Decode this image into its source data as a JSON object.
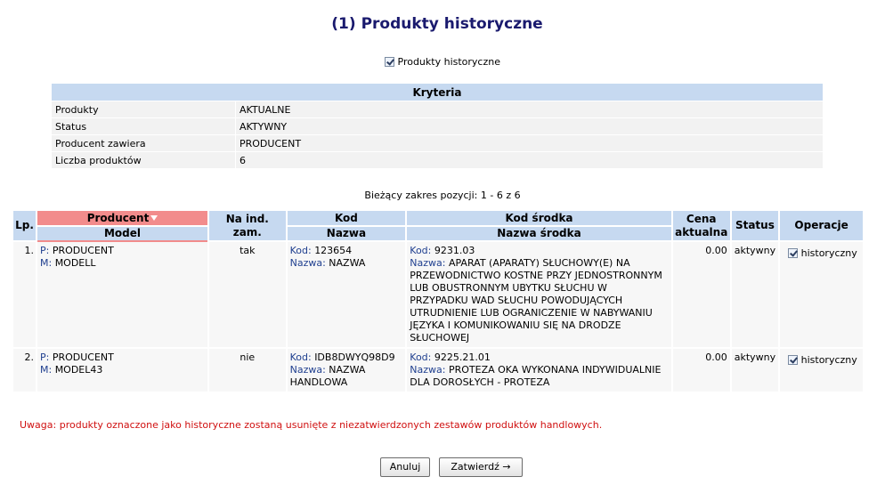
{
  "title": "(1) Produkty historyczne",
  "hist_toggle_label": "Produkty historyczne",
  "criteria": {
    "header": "Kryteria",
    "rows": [
      {
        "label": "Produkty",
        "value": "AKTUALNE"
      },
      {
        "label": "Status",
        "value": "AKTYWNY"
      },
      {
        "label": "Producent zawiera",
        "value": "PRODUCENT"
      },
      {
        "label": "Liczba produktów",
        "value": "6"
      }
    ]
  },
  "range_text": "Bieżący zakres pozycji: 1 - 6 z 6",
  "table": {
    "headers": {
      "lp": "Lp.",
      "producent": "Producent",
      "model": "Model",
      "na_ind": "Na ind. zam.",
      "kod": "Kod",
      "nazwa": "Nazwa",
      "kod_srodka": "Kod środka",
      "nazwa_srodka": "Nazwa środka",
      "cena": "Cena aktualna",
      "status": "Status",
      "operacje": "Operacje"
    },
    "rows": [
      {
        "lp": "1.",
        "p_key": "P:",
        "producer": "PRODUCENT",
        "m_key": "M:",
        "model": "MODELL",
        "na_ind": "tak",
        "kod_key": "Kod:",
        "kod": "123654",
        "nazwa_key": "Nazwa:",
        "nazwa": "NAZWA",
        "kod_srodka_key": "Kod:",
        "kod_srodka": "9231.03",
        "nazwa_srodka_key": "Nazwa:",
        "nazwa_srodka": "APARAT (APARATY) SŁUCHOWY(E) NA PRZEWODNICTWO KOSTNE PRZY JEDNOSTRONNYM LUB OBUSTRONNYM UBYTKU SŁUCHU W PRZYPADKU WAD SŁUCHU POWODUJĄCYCH UTRUDNIENIE LUB OGRANICZENIE W NABYWANIU JĘZYKA I KOMUNIKOWANIU SIĘ NA DRODZE SŁUCHOWEJ",
        "cena": "0.00",
        "status": "aktywny",
        "op_label": "historyczny"
      },
      {
        "lp": "2.",
        "p_key": "P:",
        "producer": "PRODUCENT",
        "m_key": "M:",
        "model": "MODEL43",
        "na_ind": "nie",
        "kod_key": "Kod:",
        "kod": "IDB8DWYQ98D9",
        "nazwa_key": "Nazwa:",
        "nazwa": "NAZWA HANDLOWA",
        "kod_srodka_key": "Kod:",
        "kod_srodka": "9225.21.01",
        "nazwa_srodka_key": "Nazwa:",
        "nazwa_srodka": "PROTEZA OKA WYKONANA INDYWIDUALNIE DLA DOROSŁYCH - PROTEZA",
        "cena": "0.00",
        "status": "aktywny",
        "op_label": "historyczny"
      }
    ]
  },
  "warning": "Uwaga: produkty oznaczone jako historyczne zostaną usunięte z niezatwierdzonych zestawów produktów handlowych.",
  "buttons": {
    "cancel": "Anuluj",
    "confirm": "Zatwierdź →"
  }
}
